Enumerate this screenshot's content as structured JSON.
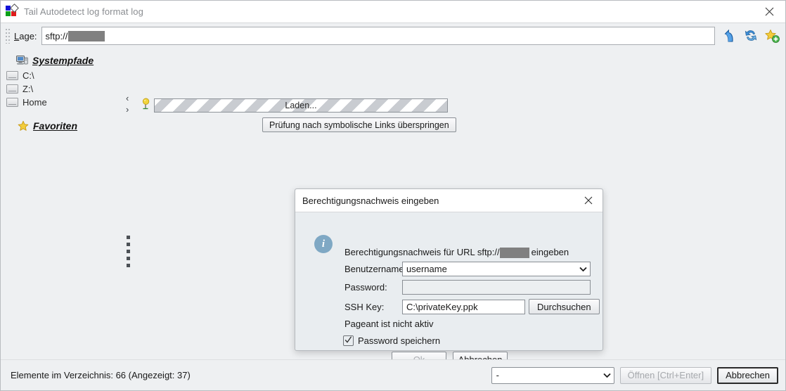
{
  "window": {
    "title": "Tail Autodetect log format log",
    "icon": "app-logo-icon",
    "close_label": "×"
  },
  "location_bar": {
    "label_prefix": "L",
    "label_rest": "age:",
    "value_prefix": "sftp://",
    "value_redacted": true,
    "toolbar_icons": [
      "up-arrow-icon",
      "refresh-icon",
      "add-favorite-star-icon"
    ]
  },
  "sidebar": {
    "sections": [
      {
        "header": "Systempfade",
        "header_icon": "computer-icon",
        "items": [
          {
            "label": "C:\\",
            "icon": "drive-icon"
          },
          {
            "label": "Z:\\",
            "icon": "drive-icon"
          },
          {
            "label": "Home",
            "icon": "drive-icon"
          }
        ]
      },
      {
        "header": "Favoriten",
        "header_icon": "star-icon",
        "items": []
      }
    ]
  },
  "content": {
    "chevron_up": "‹",
    "chevron_down": "›",
    "pin_icon": "yellow-pin-icon",
    "progress_label": "Laden...",
    "skip_button_label": "Prüfung nach symbolische Links überspringen"
  },
  "bottom_bar": {
    "status": "Elemente im Verzeichnis: 66 (Angezeigt: 37)",
    "filter_value": "-",
    "open_button": "Öffnen [Ctrl+Enter]",
    "open_button_disabled": true,
    "cancel_button": "Abbrechen"
  },
  "dialog": {
    "title": "Berechtigungsnachweis eingeben",
    "close_label": "×",
    "info_icon": "info-icon",
    "info_glyph": "i",
    "message_prefix": "Berechtigungsnachweis für URL sftp://",
    "message_suffix": "eingeben",
    "fields": {
      "username_label": "Benutzername:",
      "username_value": "username",
      "password_label": "Password:",
      "password_value": "",
      "ssh_key_label": "SSH Key:",
      "ssh_key_value": "C:\\privateKey.ppk",
      "browse_button": "Durchsuchen"
    },
    "pageant_status": "Pageant ist nicht aktiv",
    "save_password_label": "Password speichern",
    "save_password_checked": true,
    "ok_button": "Ok",
    "ok_button_disabled": true,
    "cancel_button": "Abbrechen"
  },
  "colors": {
    "window_bg": "#eef0f2",
    "dialog_bg": "#e9edf0",
    "titlebar_bg": "#ffffff",
    "info_blue": "#7fa8c4",
    "redaction_gray": "#808080",
    "accent_star": "#f0c419"
  }
}
